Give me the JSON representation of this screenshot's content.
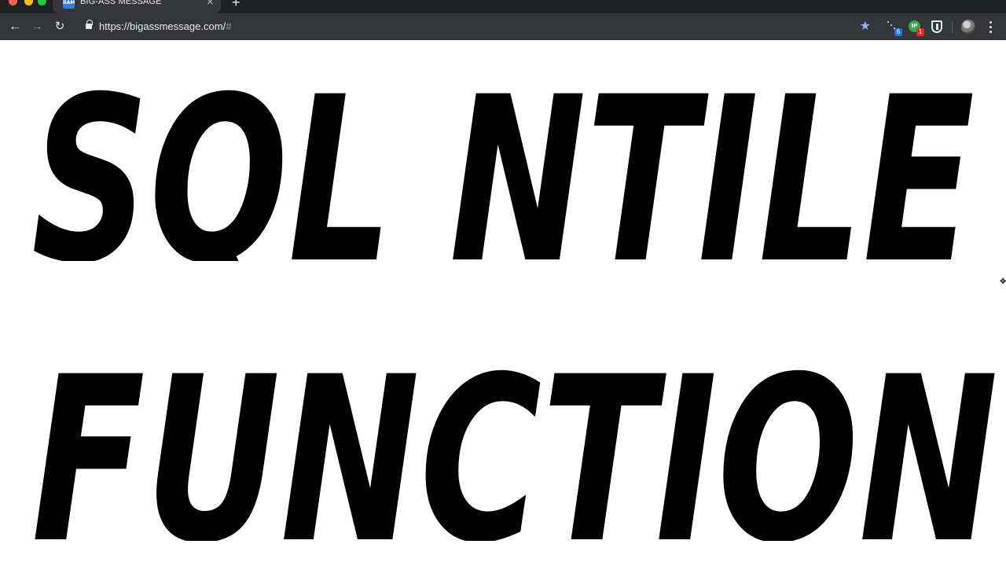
{
  "browser": {
    "tab": {
      "favicon_text": "BAM",
      "title": "BIG-ASS MESSAGE",
      "close_glyph": "×"
    },
    "new_tab_glyph": "+",
    "nav": {
      "back_glyph": "←",
      "forward_glyph": "→",
      "reload_glyph": "↻"
    },
    "address_bar": {
      "url": "https://bigassmessage.com/",
      "fragment": "#"
    },
    "bookmark_star_glyph": "★",
    "extensions": [
      {
        "icon": "extension-dots-icon",
        "badge": "6",
        "badge_color": "#1a73e8"
      },
      {
        "icon": "extension-green-circle-icon",
        "label": "IP",
        "badge": "1",
        "badge_color": "#d93025"
      },
      {
        "icon": "shield-icon"
      }
    ],
    "profile_icon": "avatar-icon",
    "menu_icon": "more-vert-icon"
  },
  "message": {
    "lines": [
      "SQL NTILE",
      "FUNCTION"
    ],
    "text_color": "#000000",
    "background": "#ffffff"
  }
}
